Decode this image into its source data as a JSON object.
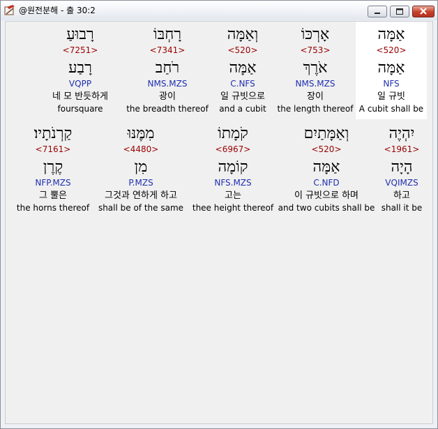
{
  "window": {
    "title": "@원전분해 - 출 30:2"
  },
  "rows": [
    [
      {
        "hebrew": "רָבוּעַ",
        "strong": "<7251>",
        "lemma": "רָבַע",
        "morph": "VQPP",
        "korean": "네 모 반듯하게",
        "english": "foursquare"
      },
      {
        "hebrew": "רָחְבּוֹ",
        "strong": "<7341>",
        "lemma": "רֹחַב",
        "morph": "NMS.MZS",
        "korean": "광이",
        "english": "the breadth thereof"
      },
      {
        "hebrew": "וְאַמָּה",
        "strong": "<520>",
        "lemma": "אַמָּה",
        "morph": "C.NFS",
        "korean": "일 규빗으로",
        "english": "and a cubit"
      },
      {
        "hebrew": "אָרְכּוֹ",
        "strong": "<753>",
        "lemma": "אֹרֶךְ",
        "morph": "NMS.MZS",
        "korean": "장이",
        "english": "the length thereof"
      },
      {
        "hebrew": "אַמָּה",
        "strong": "<520>",
        "lemma": "אַמָּה",
        "morph": "NFS",
        "korean": "일 규빗",
        "english": "A cubit shall be",
        "selected": true
      }
    ],
    [
      {
        "hebrew": "קַרְנֹתָיו׃",
        "strong": "<7161>",
        "lemma": "קֶרֶן",
        "morph": "NFP.MZS",
        "korean": "그 뿔은",
        "english": "the horns thereof"
      },
      {
        "hebrew": "מִמֶּנּוּ",
        "strong": "<4480>",
        "lemma": "מִן",
        "morph": "P.MZS",
        "korean": "그것과 연하게 하고",
        "english": "shall be of the same"
      },
      {
        "hebrew": "קֹמָתוֹ",
        "strong": "<6967>",
        "lemma": "קוֹמָה",
        "morph": "NFS.MZS",
        "korean": "고는",
        "english": "thee height thereof"
      },
      {
        "hebrew": "וְאַמָּתַיִם",
        "strong": "<520>",
        "lemma": "אַמָּה",
        "morph": "C.NFD",
        "korean": "이 규빗으로 하며",
        "english": "and two cubits shall be"
      },
      {
        "hebrew": "יִהְיֶה",
        "strong": "<1961>",
        "lemma": "הָיָה",
        "morph": "VQIMZS",
        "korean": "하고",
        "english": "shall it be"
      }
    ]
  ]
}
